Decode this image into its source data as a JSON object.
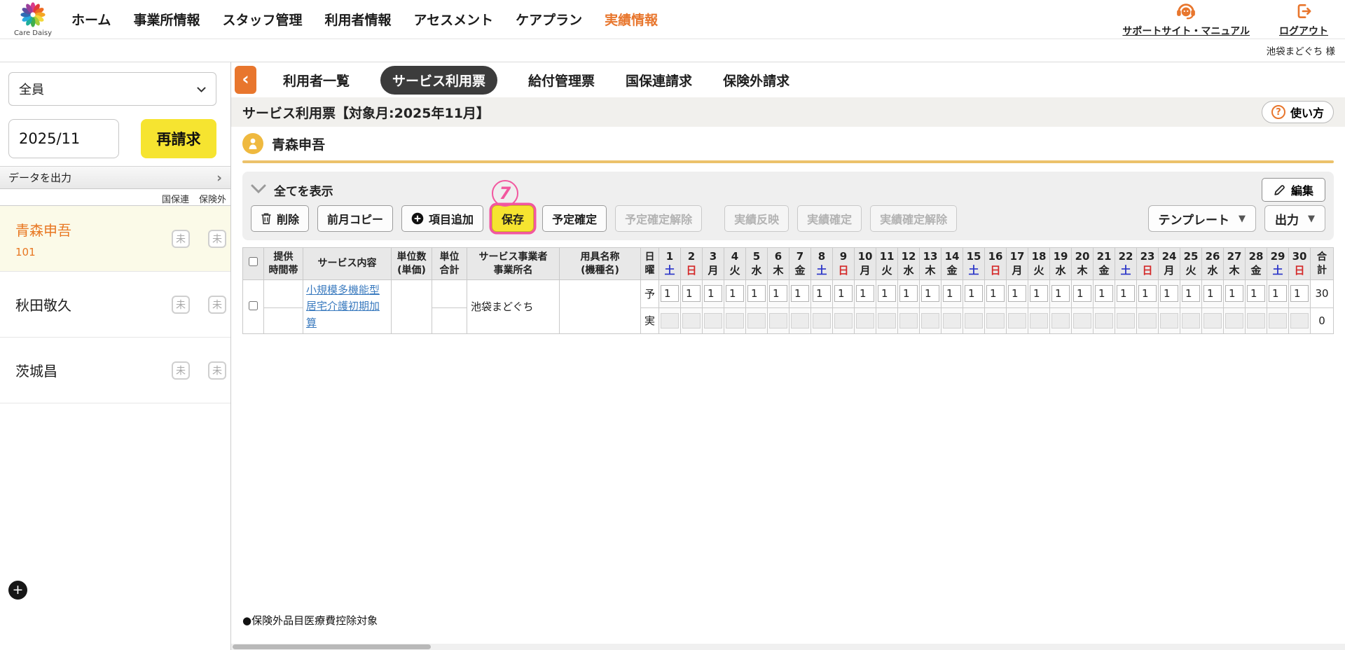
{
  "colors": {
    "accent_orange": "#E8762D",
    "primary_yellow": "#F6E430",
    "highlight_pink": "#F2579F",
    "link_blue": "#3B7BBF",
    "saturday_blue": "#2A35C8",
    "sunday_red": "#D42A2A",
    "selected_row_bg": "#FBFAE8"
  },
  "icons": {
    "caret_down": "▼",
    "chevron_right": "›"
  },
  "topnav": {
    "logo_text": "Care Daisy",
    "items": [
      {
        "label": "ホーム",
        "active": false
      },
      {
        "label": "事業所情報",
        "active": false
      },
      {
        "label": "スタッフ管理",
        "active": false
      },
      {
        "label": "利用者情報",
        "active": false
      },
      {
        "label": "アセスメント",
        "active": false
      },
      {
        "label": "ケアプラン",
        "active": false
      },
      {
        "label": "実績情報",
        "active": true
      }
    ],
    "support_link": "サポートサイト・マニュアル",
    "logout_link": "ログアウト"
  },
  "userbar": {
    "office_name": "池袋まどぐち 様"
  },
  "sidebar": {
    "filter_value": "全員",
    "month_value": "2025/11",
    "rebill_button": "再請求",
    "export_label": "データを出力",
    "status_headers": [
      "国保連",
      "保険外"
    ],
    "users": [
      {
        "name": "青森申吾",
        "code": "101",
        "selected": true,
        "badges": [
          "未",
          "未"
        ]
      },
      {
        "name": "秋田敬久",
        "code": "",
        "selected": false,
        "badges": [
          "未",
          "未"
        ]
      },
      {
        "name": "茨城昌",
        "code": "",
        "selected": false,
        "badges": [
          "未",
          "未"
        ]
      }
    ],
    "add_button": "+"
  },
  "tabs": {
    "back_label": "‹",
    "items": [
      {
        "label": "利用者一覧",
        "active": false
      },
      {
        "label": "サービス利用票",
        "active": true
      },
      {
        "label": "給付管理票",
        "active": false
      },
      {
        "label": "国保連請求",
        "active": false
      },
      {
        "label": "保険外請求",
        "active": false
      }
    ]
  },
  "titlebar": {
    "title": "サービス利用票【対象月:2025年11月】",
    "help_icon": "?",
    "help_label": "使い方"
  },
  "user_header": {
    "name": "青森申吾"
  },
  "panel": {
    "show_all": "全てを表示",
    "edit_button": "編集",
    "annotation": "7",
    "toolbar": [
      {
        "label": "削除",
        "icon": "trash",
        "enabled": true
      },
      {
        "label": "前月コピー",
        "enabled": true
      },
      {
        "label": "項目追加",
        "icon": "plus",
        "enabled": true
      },
      {
        "label": "保存",
        "enabled": true,
        "highlighted": true
      },
      {
        "label": "予定確定",
        "enabled": true
      },
      {
        "label": "予定確定解除",
        "enabled": false
      },
      {
        "label": "実績反映",
        "enabled": false,
        "gap_before": true
      },
      {
        "label": "実績確定",
        "enabled": false
      },
      {
        "label": "実績確定解除",
        "enabled": false
      }
    ],
    "template_button": "テンプレート",
    "output_button": "出力"
  },
  "table": {
    "col_headers": [
      "提供|時間帯",
      "サービス内容",
      "単位数|(単価)",
      "単位|合計",
      "サービス事業者|事業所名",
      "用具名称|(機種名)",
      "日|曜"
    ],
    "total_header": "合|計",
    "days": [
      {
        "d": "1",
        "w": "土"
      },
      {
        "d": "2",
        "w": "日"
      },
      {
        "d": "3",
        "w": "月"
      },
      {
        "d": "4",
        "w": "火"
      },
      {
        "d": "5",
        "w": "水"
      },
      {
        "d": "6",
        "w": "木"
      },
      {
        "d": "7",
        "w": "金"
      },
      {
        "d": "8",
        "w": "土"
      },
      {
        "d": "9",
        "w": "日"
      },
      {
        "d": "10",
        "w": "月"
      },
      {
        "d": "11",
        "w": "火"
      },
      {
        "d": "12",
        "w": "水"
      },
      {
        "d": "13",
        "w": "木"
      },
      {
        "d": "14",
        "w": "金"
      },
      {
        "d": "15",
        "w": "土"
      },
      {
        "d": "16",
        "w": "日"
      },
      {
        "d": "17",
        "w": "月"
      },
      {
        "d": "18",
        "w": "火"
      },
      {
        "d": "19",
        "w": "水"
      },
      {
        "d": "20",
        "w": "木"
      },
      {
        "d": "21",
        "w": "金"
      },
      {
        "d": "22",
        "w": "土"
      },
      {
        "d": "23",
        "w": "日"
      },
      {
        "d": "24",
        "w": "月"
      },
      {
        "d": "25",
        "w": "火"
      },
      {
        "d": "26",
        "w": "水"
      },
      {
        "d": "27",
        "w": "木"
      },
      {
        "d": "28",
        "w": "金"
      },
      {
        "d": "29",
        "w": "土"
      },
      {
        "d": "30",
        "w": "日"
      }
    ],
    "row": {
      "service_link": "小規模多機能型居宅介護初期加算",
      "provider": "池袋まどぐち",
      "plan_label": "予",
      "actual_label": "実",
      "plan_values": [
        "1",
        "1",
        "1",
        "1",
        "1",
        "1",
        "1",
        "1",
        "1",
        "1",
        "1",
        "1",
        "1",
        "1",
        "1",
        "1",
        "1",
        "1",
        "1",
        "1",
        "1",
        "1",
        "1",
        "1",
        "1",
        "1",
        "1",
        "1",
        "1",
        "1"
      ],
      "plan_total": "30",
      "actual_values": [
        "",
        "",
        "",
        "",
        "",
        "",
        "",
        "",
        "",
        "",
        "",
        "",
        "",
        "",
        "",
        "",
        "",
        "",
        "",
        "",
        "",
        "",
        "",
        "",
        "",
        "",
        "",
        "",
        "",
        ""
      ],
      "actual_total": "0"
    }
  },
  "footnote": "●保険外品目医療費控除対象"
}
